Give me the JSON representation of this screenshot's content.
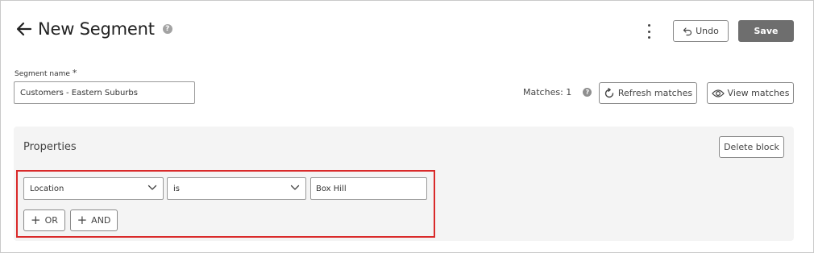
{
  "header": {
    "title": "New Segment",
    "help_icon": "question-circle-icon",
    "back_icon": "arrow-left-icon",
    "more_icon": "kebab-vertical-icon",
    "undo_label": "Undo",
    "undo_icon": "undo-arrow-icon",
    "save_label": "Save"
  },
  "segment": {
    "name_label": "Segment name",
    "required_marker": "*",
    "name_value": "Customers - Eastern Suburbs"
  },
  "matches": {
    "label": "Matches: 1",
    "help_icon": "question-circle-icon",
    "refresh_label": "Refresh matches",
    "refresh_icon": "refresh-icon",
    "view_label": "View matches",
    "view_icon": "eye-icon"
  },
  "properties": {
    "title": "Properties",
    "delete_block_label": "Delete block",
    "rule": {
      "field": "Location",
      "operator": "is",
      "value": "Box Hill",
      "dropdown_icon": "chevron-down-icon"
    },
    "or_label": "OR",
    "and_label": "AND",
    "plus_icon": "plus-icon"
  },
  "colors": {
    "save_bg": "#6e6e6e",
    "highlight_border": "#d92a2a",
    "panel_bg": "#f4f4f4"
  }
}
